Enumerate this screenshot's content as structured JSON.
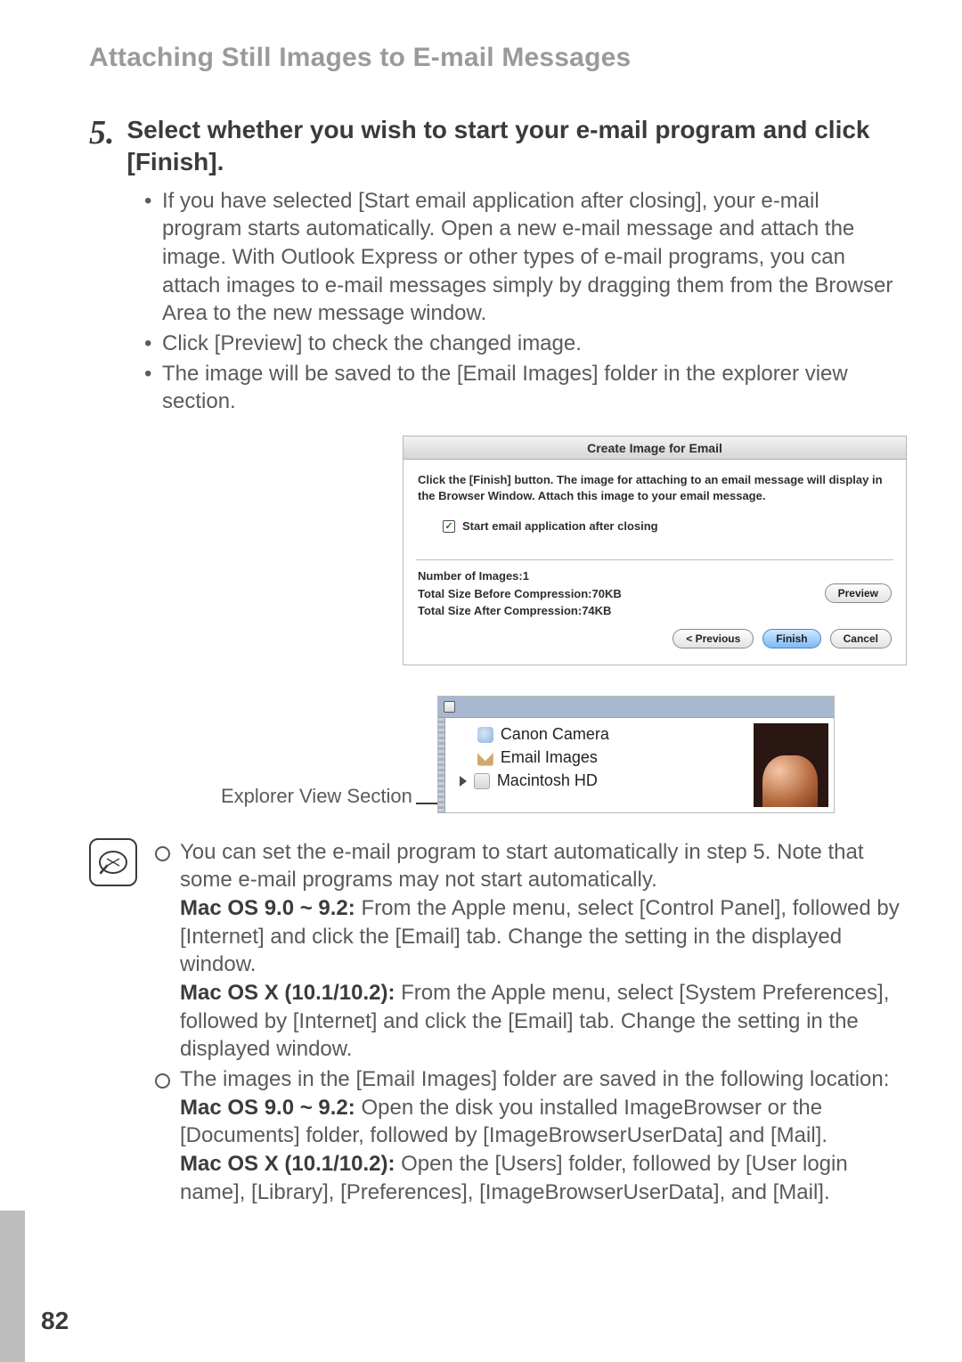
{
  "section_title": "Attaching Still Images to E-mail Messages",
  "step": {
    "number": "5.",
    "heading": "Select whether you wish to start your e-mail program and click [Finish]."
  },
  "bullets": [
    "If you have selected [Start email application after closing], your e-mail program starts automatically. Open a new e-mail message and attach the image. With Outlook Express or other types of e-mail programs, you can attach images to e-mail messages simply by dragging them from the Browser Area to the new message window.",
    "Click [Preview] to check the changed image.",
    "The image will be saved to the [Email Images] folder in the explorer view section."
  ],
  "dialog": {
    "title": "Create Image for Email",
    "instruction": "Click the [Finish] button. The image for attaching to an email message will display in the Browser Window. Attach this image to your email message.",
    "checkbox_label": "Start email application after closing",
    "num_images": "Number of Images:1",
    "before_comp": "Total Size Before Compression:70KB",
    "after_comp": "Total Size After Compression:74KB",
    "btn_preview": "Preview",
    "btn_prev": "< Previous",
    "btn_finish": "Finish",
    "btn_cancel": "Cancel"
  },
  "explorer": {
    "label": "Explorer View Section",
    "items": [
      "Canon Camera",
      "Email Images",
      "Macintosh HD"
    ]
  },
  "notes": {
    "n1_a": "You can set the e-mail program to start automatically in step 5. Note that some e-mail programs may not start automatically.",
    "n1_b_bold": "Mac OS 9.0 ~ 9.2:",
    "n1_b": " From the Apple menu, select [Control Panel], followed by [Internet] and click the [Email] tab. Change the setting in the displayed window.",
    "n1_c_bold": "Mac OS X (10.1/10.2):",
    "n1_c": " From the Apple menu, select [System Preferences], followed by [Internet] and click the [Email] tab. Change the setting in the displayed window.",
    "n2_a": "The images in the [Email Images] folder are saved in the following location:",
    "n2_b_bold": "Mac OS 9.0 ~ 9.2:",
    "n2_b": " Open the disk you installed ImageBrowser or the [Documents] folder, followed by [ImageBrowserUserData] and [Mail].",
    "n2_c_bold": "Mac OS X (10.1/10.2):",
    "n2_c": " Open the [Users] folder, followed by [User login name], [Library], [Preferences], [ImageBrowserUserData], and [Mail]."
  },
  "page_number": "82"
}
